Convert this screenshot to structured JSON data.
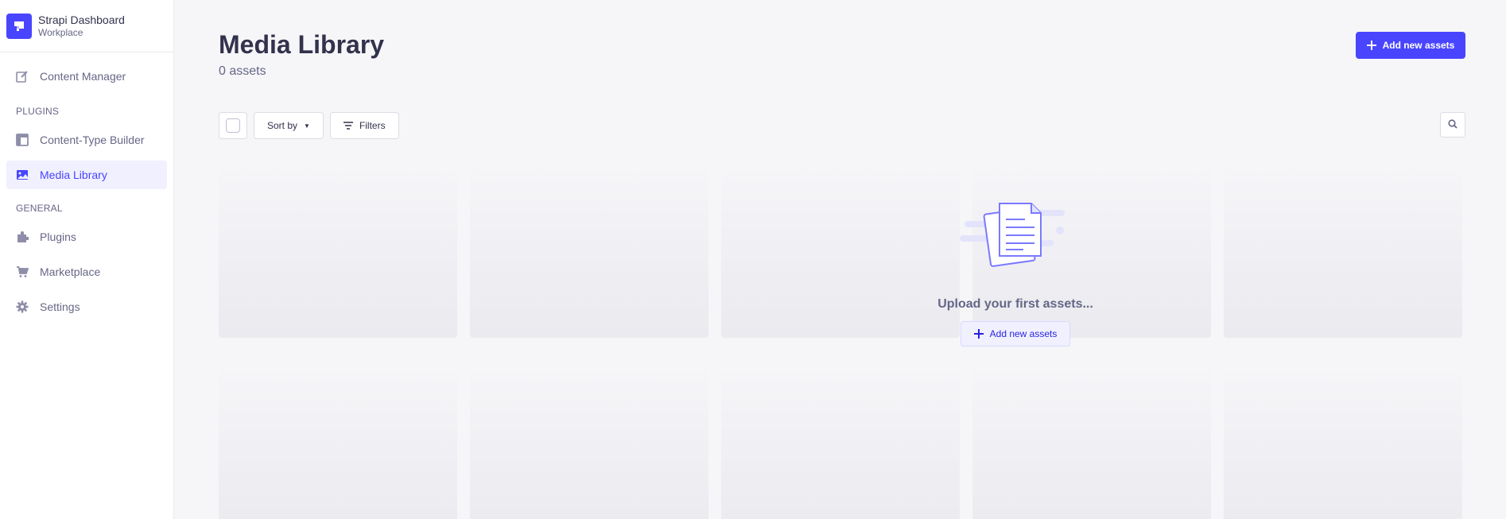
{
  "brand": {
    "title": "Strapi Dashboard",
    "subtitle": "Workplace"
  },
  "sidebar": {
    "items_top": [
      {
        "label": "Content Manager",
        "icon": "pen-icon",
        "active": false
      }
    ],
    "plugins_heading": "PLUGINS",
    "plugins": [
      {
        "label": "Content-Type Builder",
        "icon": "layout-icon",
        "active": false
      },
      {
        "label": "Media Library",
        "icon": "image-icon",
        "active": true
      }
    ],
    "general_heading": "GENERAL",
    "general": [
      {
        "label": "Plugins",
        "icon": "puzzle-icon",
        "active": false
      },
      {
        "label": "Marketplace",
        "icon": "cart-icon",
        "active": false
      },
      {
        "label": "Settings",
        "icon": "gear-icon",
        "active": false
      }
    ]
  },
  "header": {
    "title": "Media Library",
    "subtitle": "0 assets",
    "add_button": "Add new assets"
  },
  "toolbar": {
    "sort_label": "Sort by",
    "filters_label": "Filters"
  },
  "empty_state": {
    "message": "Upload your first assets...",
    "button": "Add new assets"
  },
  "colors": {
    "accent": "#4945ff",
    "active_bg": "#f0f0ff",
    "background": "#f6f6f9"
  }
}
